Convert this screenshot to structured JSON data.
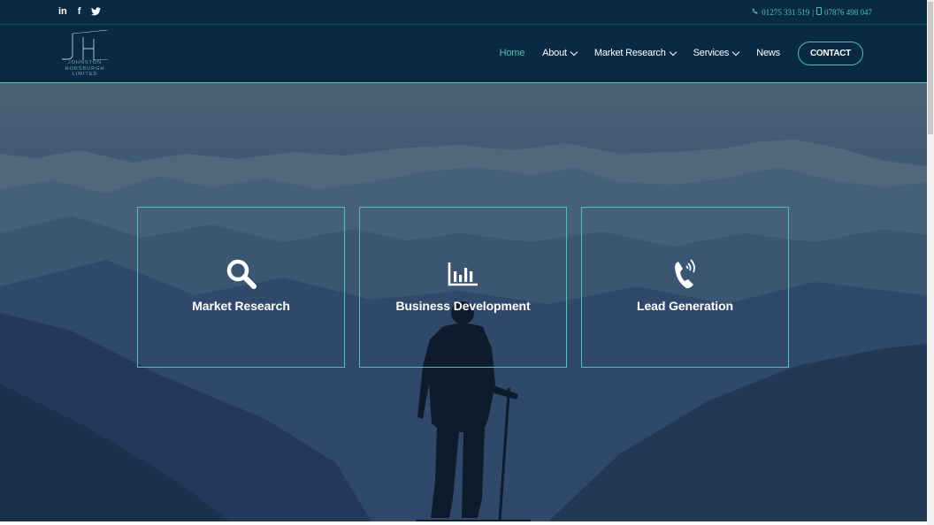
{
  "topbar": {
    "social": [
      {
        "icon": "linkedin-icon",
        "glyph": "in"
      },
      {
        "icon": "facebook-icon",
        "glyph": "f"
      },
      {
        "icon": "twitter-icon",
        "glyph": "🐦"
      }
    ],
    "phone": "01275 331 519",
    "mobile": "07876 498 047",
    "separator": "|"
  },
  "logo": {
    "line1": "JOHNSTON",
    "line2": "HORSBURGH",
    "line3": "LIMITED"
  },
  "nav": {
    "items": [
      {
        "label": "Home",
        "active": true
      },
      {
        "label": "About",
        "dropdown": true
      },
      {
        "label": "Market Research",
        "dropdown": true
      },
      {
        "label": "Services",
        "dropdown": true
      },
      {
        "label": "News"
      }
    ],
    "contact_label": "CONTACT"
  },
  "cards": [
    {
      "icon": "search-icon",
      "label": "Market Research"
    },
    {
      "icon": "bar-chart-icon",
      "label": "Business Development"
    },
    {
      "icon": "phone-icon",
      "label": "Lead Generation"
    }
  ],
  "colors": {
    "accent": "#4fc3b3",
    "navy": "#082a45"
  }
}
